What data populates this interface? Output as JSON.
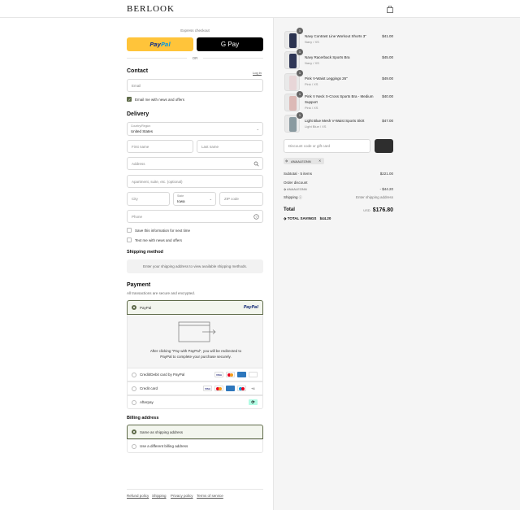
{
  "brand": {
    "logo": "BERLOOK"
  },
  "express": {
    "label": "Express checkout",
    "paypal_label_a": "Pay",
    "paypal_label_b": "Pal",
    "gpay_label": "G Pay",
    "or_label": "OR"
  },
  "contact": {
    "heading": "Contact",
    "login_link": "Log in",
    "email_placeholder": "Email",
    "email_news_label": "Email me with news and offers"
  },
  "delivery": {
    "heading": "Delivery",
    "country_label": "Country/Region",
    "country_value": "United States",
    "first_name_placeholder": "First name",
    "last_name_placeholder": "Last name",
    "address_placeholder": "Address",
    "apartment_placeholder": "Apartment, suite, etc. (optional)",
    "city_placeholder": "City",
    "state_label": "State",
    "state_value": "Iowa",
    "zip_placeholder": "ZIP code",
    "phone_placeholder": "Phone",
    "save_info_label": "Save this information for next time",
    "text_news_label": "Text me with news and offers"
  },
  "shipping_method": {
    "heading": "Shipping method",
    "notice": "Enter your shipping address to view available shipping methods."
  },
  "payment": {
    "heading": "Payment",
    "subtitle": "All transactions are secure and encrypted.",
    "options": [
      {
        "label": "PayPal",
        "brand": "PayPal"
      },
      {
        "label": "Credit/Debit card by PayPal"
      },
      {
        "label": "Credit card",
        "more": "+4"
      },
      {
        "label": "Afterpay"
      }
    ],
    "redirect_text_1": "After clicking \"Pay with PayPal\", you will be redirected to",
    "redirect_text_2": "PayPal to complete your purchase securely.",
    "card_logos": [
      "VISA",
      "MC",
      "AMEX",
      "DISC"
    ]
  },
  "billing": {
    "heading": "Billing address",
    "options": [
      "Same as shipping address",
      "Use a different billing address"
    ]
  },
  "footer": {
    "links": [
      "Refund policy",
      "Shipping",
      "Privacy policy",
      "Terms of service"
    ]
  },
  "cart": {
    "items": [
      {
        "qty": "1",
        "name": "Navy Contrast Line Workout Shorts 3\"",
        "variant": "Navy / XS",
        "price": "$41.00",
        "color": "#2b3350"
      },
      {
        "qty": "1",
        "name": "Navy Racerback Sports Bra",
        "variant": "Navy / XS",
        "price": "$45.00",
        "color": "#2f3656"
      },
      {
        "qty": "1",
        "name": "Pink V-Waist Leggings 26\"",
        "variant": "Pink / XS",
        "price": "$49.00",
        "color": "#e8d6d8"
      },
      {
        "qty": "1",
        "name": "Pink V Neck X-Cross Sports Bra - Medium Support",
        "variant": "Pink / XS",
        "price": "$40.00",
        "color": "#dcb9b6"
      },
      {
        "qty": "1",
        "name": "Light Blue Mesh V-Waist Sports Skirt",
        "variant": "Light Blue / XS",
        "price": "$47.00",
        "color": "#8a9aa0"
      }
    ],
    "discount_placeholder": "Discount code or gift card",
    "applied_code": "ANAALEONN",
    "subtotal_label": "Subtotal · 5 items",
    "subtotal_value": "$221.00",
    "order_discount_label": "Order discount",
    "discount_code_line": "ANAALEONN",
    "discount_value": "- $44.20",
    "shipping_label": "Shipping",
    "shipping_value": "Enter shipping address",
    "total_label": "Total",
    "total_currency": "USD",
    "total_value": "$176.80",
    "savings_label": "TOTAL SAVINGS",
    "savings_value": "$44.20"
  }
}
